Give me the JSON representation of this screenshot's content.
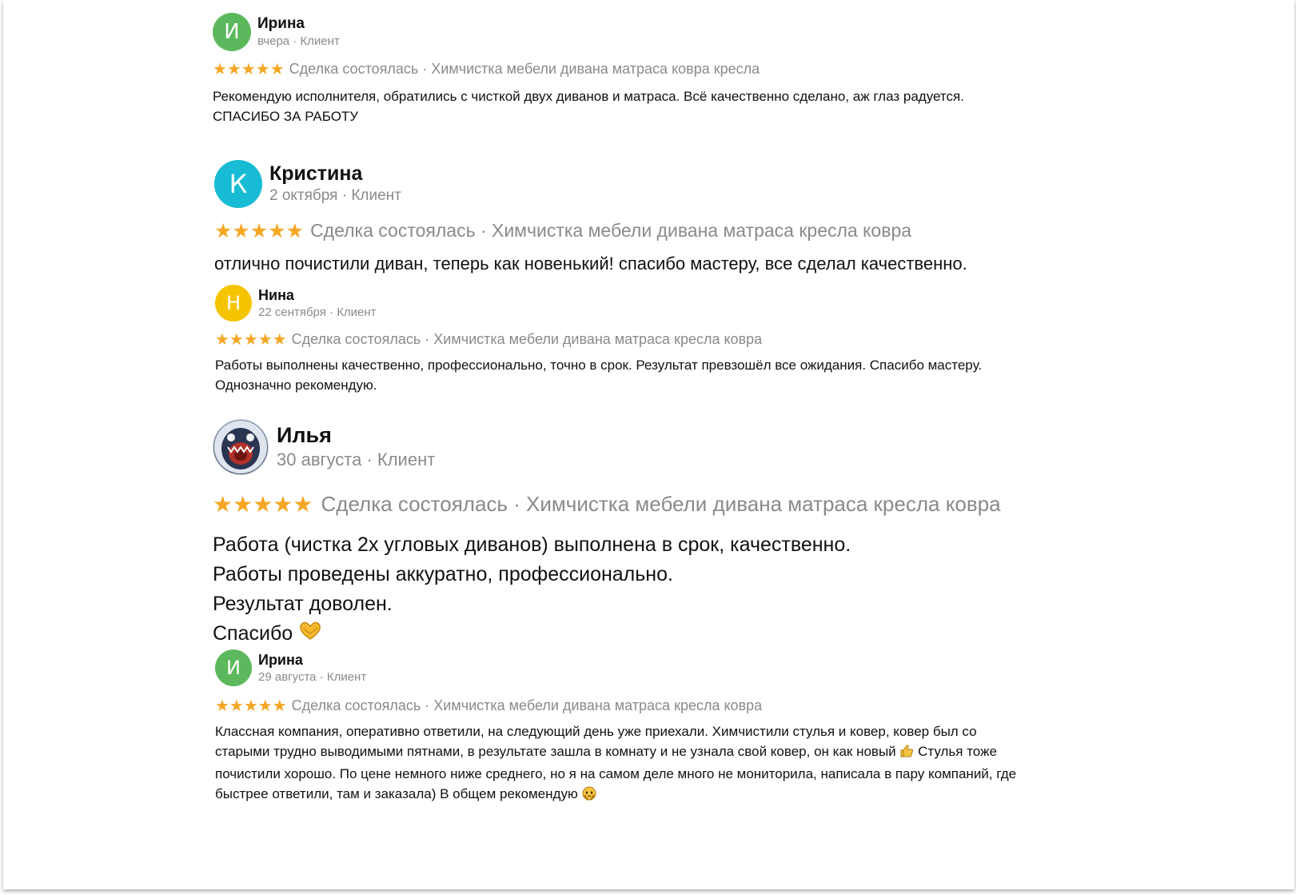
{
  "colors": {
    "star": "#f5a623",
    "meta_text": "#8a8a8a",
    "avatar_green": "#5cb85c",
    "avatar_cyan": "#17bcd4",
    "avatar_yellow": "#f5c400"
  },
  "reviews": [
    {
      "avatar_letter": "И",
      "name": "Ирина",
      "meta": "вчера · Клиент",
      "stars": "★★★★★",
      "rating": 5,
      "deal": "Сделка состоялась · Химчистка мебели дивана матраса ковра кресла",
      "text": [
        "Рекомендую исполнителя, обратились с чисткой двух диванов и матраса. Всё качественно сделано, аж глаз радуется.",
        "СПАСИБО ЗА РАБОТУ"
      ]
    },
    {
      "avatar_letter": "К",
      "name": "Кристина",
      "meta": "2 октября · Клиент",
      "stars": "★★★★★",
      "rating": 5,
      "deal": "Сделка состоялась · Химчистка мебели дивана матраса кресла ковра",
      "text": [
        "отлично почистили диван, теперь как новенький! спасибо мастеру, все сделал качественно."
      ]
    },
    {
      "avatar_letter": "Н",
      "name": "Нина",
      "meta": "22 сентября · Клиент",
      "stars": "★★★★★",
      "rating": 5,
      "deal": "Сделка состоялась · Химчистка мебели дивана матраса кресла ковра",
      "text": [
        "Работы выполнены качественно, профессионально, точно в срок. Результат превзошёл все ожидания. Спасибо мастеру.",
        "Однозначно рекомендую."
      ]
    },
    {
      "avatar_letter": "",
      "name": "Илья",
      "meta": "30 августа · Клиент",
      "stars": "★★★★★",
      "rating": 5,
      "deal": "Сделка состоялась · Химчистка мебели дивана матраса кресла ковра",
      "text": [
        "Работа (чистка 2х угловых диванов) выполнена в срок, качественно.",
        "Работы проведены аккуратно, профессионально.",
        "Результат доволен.",
        "Спасибо"
      ],
      "emoji": "heart-hands-icon"
    },
    {
      "avatar_letter": "И",
      "name": "Ирина",
      "meta": "29 августа · Клиент",
      "stars": "★★★★★",
      "rating": 5,
      "deal": "Сделка состоялась · Химчистка мебели дивана матраса кресла ковра",
      "text_parts": {
        "before_thumb": "Классная компания, оперативно ответили, на следующий день уже приехали. Химчистили стулья и ковер, ковер был со старыми трудно выводимыми пятнами, в результате зашла в комнату и не узнала свой ковер, он как новый ",
        "after_thumb": "Стулья тоже почистили хорошо. По цене немного ниже среднего, но я на самом деле много не мониторила, написала в пару компаний, где быстрее ответили, там и заказала) В общем рекомендую "
      },
      "emojis": [
        "thumbs-up-icon",
        "grateful-face-icon"
      ]
    }
  ]
}
